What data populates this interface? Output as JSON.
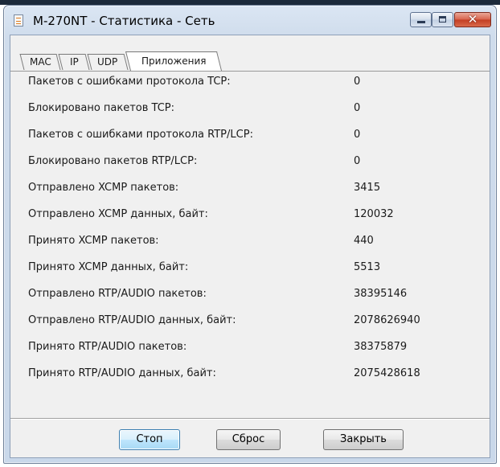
{
  "window": {
    "title": "M-270NT - Статистика - Сеть"
  },
  "caption_buttons": {
    "close_glyph": "✕"
  },
  "tabs": [
    {
      "label": "MAC",
      "active": false
    },
    {
      "label": "IP",
      "active": false
    },
    {
      "label": "UDP",
      "active": false
    },
    {
      "label": "Приложения",
      "active": true
    }
  ],
  "stats": [
    {
      "label": "Пакетов с ошибками протокола TCP:",
      "value": "0"
    },
    {
      "label": "Блокировано пакетов TCP:",
      "value": "0"
    },
    {
      "label": "Пакетов с ошибками протокола RTP/LCP:",
      "value": "0"
    },
    {
      "label": "Блокировано пакетов RTP/LCP:",
      "value": "0"
    },
    {
      "label": "Отправлено XCMP пакетов:",
      "value": "3415"
    },
    {
      "label": "Отправлено XCMP данных, байт:",
      "value": "120032"
    },
    {
      "label": "Принято XCMP пакетов:",
      "value": "440"
    },
    {
      "label": "Принято XCMP данных, байт:",
      "value": "5513"
    },
    {
      "label": "Отправлено RTP/AUDIO пакетов:",
      "value": "38395146"
    },
    {
      "label": "Отправлено RTP/AUDIO данных, байт:",
      "value": "2078626940"
    },
    {
      "label": "Принято RTP/AUDIO пакетов:",
      "value": "38375879"
    },
    {
      "label": "Принято RTP/AUDIO данных, байт:",
      "value": "2075428618"
    }
  ],
  "buttons": {
    "stop": "Стоп",
    "reset": "Сброс",
    "close": "Закрыть"
  }
}
